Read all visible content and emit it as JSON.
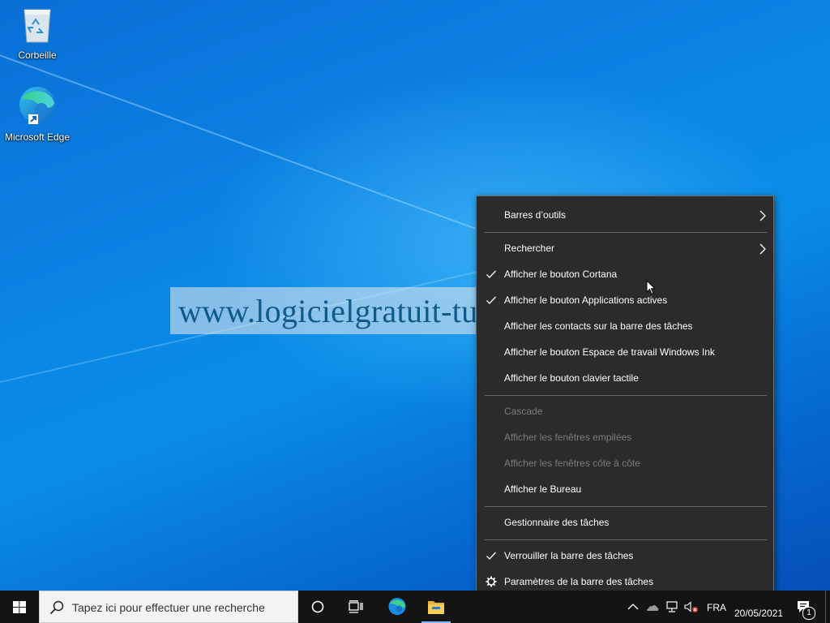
{
  "desktop": {
    "icons": [
      {
        "label": "Corbeille",
        "icon": "recycle-bin-icon"
      },
      {
        "label": "Microsoft Edge",
        "icon": "edge-icon"
      }
    ]
  },
  "watermark": {
    "text": "www.logicielgratuit-tuto.com"
  },
  "context_menu": {
    "items": [
      {
        "label": "Barres d’outils",
        "submenu": true
      },
      {
        "label": "Rechercher",
        "submenu": true
      },
      {
        "label": "Afficher le bouton Cortana",
        "checked": true
      },
      {
        "label": "Afficher le bouton Applications actives",
        "checked": true
      },
      {
        "label": "Afficher les contacts sur la barre des tâches"
      },
      {
        "label": "Afficher le bouton Espace de travail Windows Ink"
      },
      {
        "label": "Afficher le bouton clavier tactile"
      },
      {
        "label": "Cascade",
        "disabled": true
      },
      {
        "label": "Afficher les fenêtres empilées",
        "disabled": true
      },
      {
        "label": "Afficher les fenêtres côte à côte",
        "disabled": true
      },
      {
        "label": "Afficher le Bureau"
      },
      {
        "label": "Gestionnaire des tâches"
      },
      {
        "label": "Verrouiller la barre des tâches",
        "checked": true
      },
      {
        "label": "Paramètres de la barre des tâches",
        "icon": "gear-icon"
      }
    ]
  },
  "taskbar": {
    "search_placeholder": "Tapez ici pour effectuer une recherche",
    "language": "FRA",
    "date": "20/05/2021",
    "notification_count": "1"
  },
  "colors": {
    "menu_bg": "#2b2b2b",
    "taskbar_bg": "#141414",
    "desktop_accent": "#0a84e4"
  }
}
